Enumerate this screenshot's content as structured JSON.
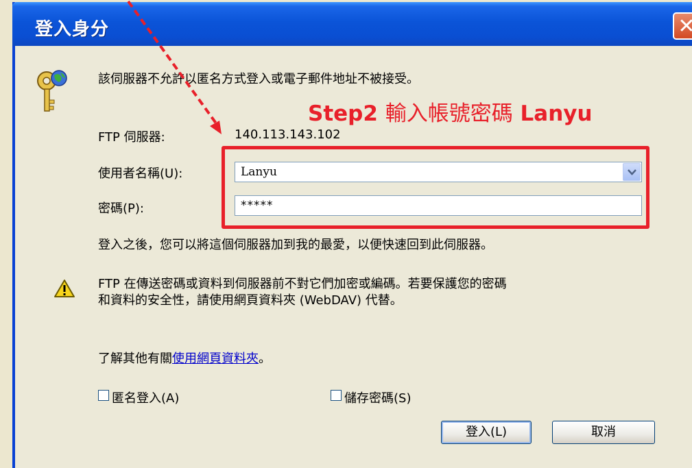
{
  "window": {
    "title": "登入身分",
    "close_symbol": "✕"
  },
  "message": "該伺服器不允許以匿名方式登入或電子郵件地址不被接受。",
  "annotation": {
    "step_prefix": "Step2",
    "step_text": "輸入帳號密碼",
    "step_suffix": "Lanyu",
    "color": "#e8202a"
  },
  "server": {
    "label": "FTP 伺服器:",
    "value": "140.113.143.102"
  },
  "username": {
    "label": "使用者名稱(U):",
    "value": "Lanyu"
  },
  "password": {
    "label": "密碼(P):",
    "value": "*****"
  },
  "favorites_note": "登入之後，您可以將這個伺服器加到我的最愛，以便快速回到此伺服器。",
  "warning": {
    "line1": "FTP 在傳送密碼或資料到伺服器前不對它們加密或編碼。若要保護您的密碼",
    "line2": "和資料的安全性，請使用網頁資料夾 (WebDAV) 代替。"
  },
  "learn_more": {
    "prefix": "了解其他有關",
    "link": "使用網頁資料夾",
    "suffix": "。"
  },
  "options": {
    "anonymous_label": "匿名登入(A)",
    "anonymous_checked": false,
    "save_password_label": "儲存密碼(S)",
    "save_password_checked": false
  },
  "buttons": {
    "login": "登入(L)",
    "cancel": "取消"
  },
  "colors": {
    "titlebar": "#0b54d8",
    "dialog_bg": "#ece9d8",
    "link": "#0000cc"
  }
}
